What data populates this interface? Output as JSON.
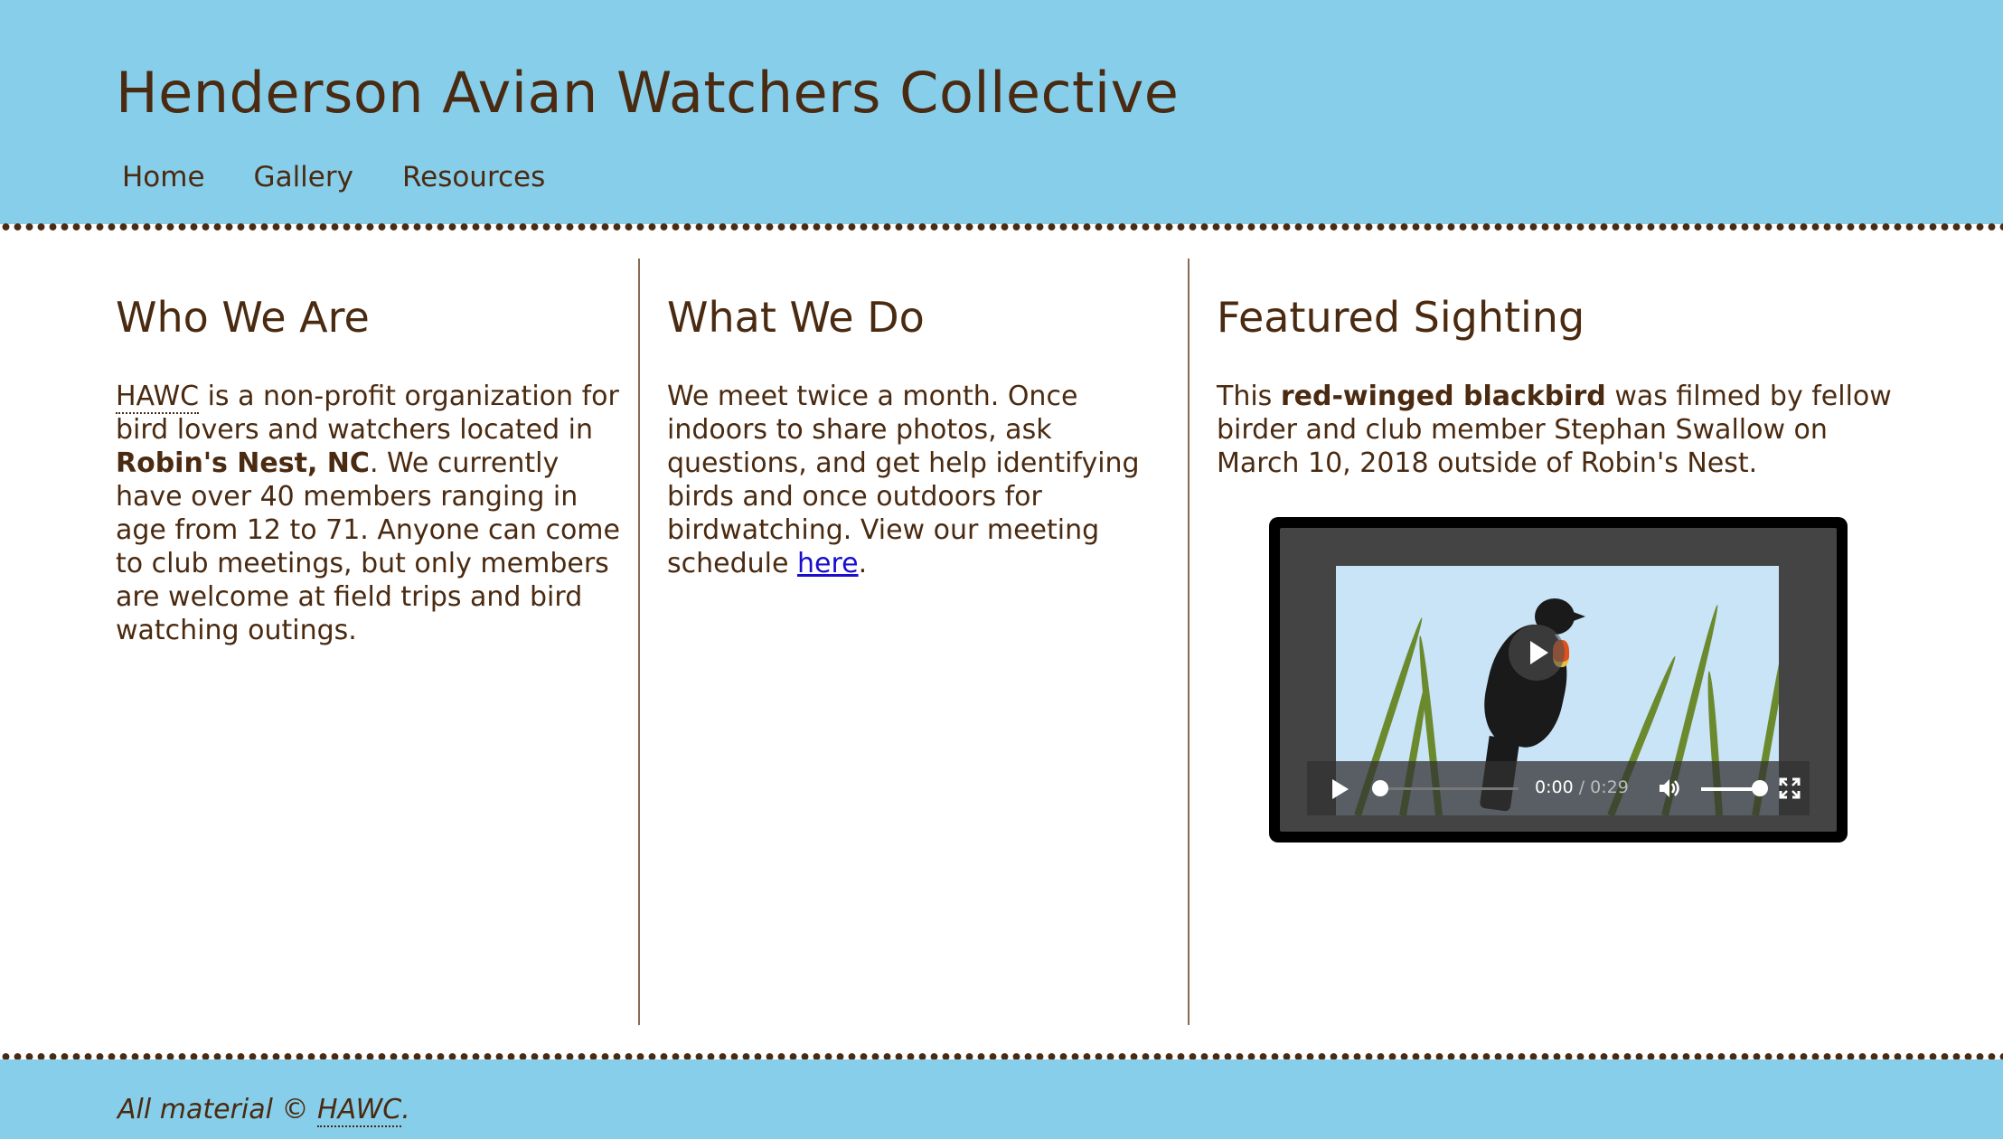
{
  "site": {
    "title": "Henderson Avian Watchers Collective"
  },
  "nav": {
    "items": [
      {
        "label": "Home"
      },
      {
        "label": "Gallery"
      },
      {
        "label": "Resources"
      }
    ]
  },
  "who": {
    "heading": "Who We Are",
    "abbr": "HAWC",
    "text1": " is a non-profit organization for bird lovers and watchers located in ",
    "location": "Robin's Nest, NC",
    "text2": ". We currently have over 40 members ranging in age from 12 to 71. Anyone can come to club meetings, but only members are welcome at field trips and bird watching outings."
  },
  "what": {
    "heading": "What We Do",
    "text1": "We meet twice a month. Once indoors to share photos, ask questions, and get help identifying birds and once outdoors for birdwatching. View our meeting schedule ",
    "link": "here",
    "text2": "."
  },
  "featured": {
    "heading": "Featured Sighting",
    "text1": "This ",
    "bird": "red-winged blackbird",
    "text2": " was filmed by fellow birder and club member Stephan Swallow on March 10, 2018 outside of Robin's Nest."
  },
  "video": {
    "current_time": "0:00",
    "separator": " / ",
    "duration": "0:29",
    "progress": 0,
    "volume": 1
  },
  "footer": {
    "prefix": "All material © ",
    "abbr": "HAWC",
    "suffix": "."
  },
  "colors": {
    "header_bg": "#87ceeb",
    "text": "#4a2a10",
    "link": "#1a0dce"
  },
  "icons": [
    "play-icon",
    "volume-icon",
    "fullscreen-icon"
  ]
}
